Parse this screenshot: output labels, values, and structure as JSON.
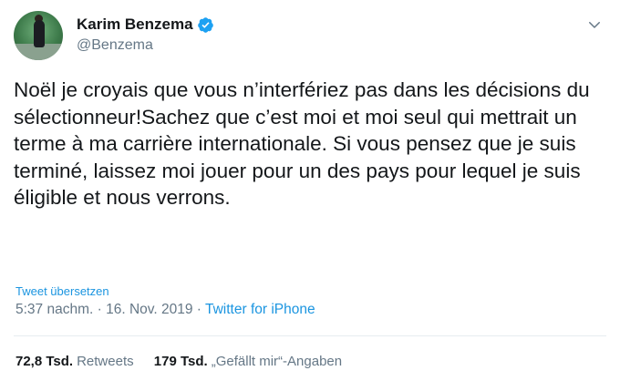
{
  "user": {
    "display_name": "Karim Benzema",
    "handle": "@Benzema",
    "verified": true
  },
  "tweet": {
    "text": "Noël je croyais que vous n’interfériez pas dans les décisions du sélectionneur!Sachez que c’est moi et moi seul qui mettrait un terme à ma carrière internationale. Si vous pensez que je suis terminé, laissez moi jouer pour un des pays pour lequel je suis éligible et nous verrons.",
    "translate_label": "Tweet übersetzen",
    "time": "5:37 nachm.",
    "separator_1": "·",
    "date": "16. Nov. 2019",
    "separator_2": "·",
    "source": "Twitter for iPhone"
  },
  "stats": {
    "retweets_count": "72,8 Tsd.",
    "retweets_label": "Retweets",
    "likes_count": "179 Tsd.",
    "likes_label": "„Gefällt mir“-Angaben"
  },
  "colors": {
    "link": "#1b95e0",
    "muted": "#657786",
    "verified": "#1da1f2"
  },
  "icons": [
    "verified-badge-icon",
    "chevron-down-icon"
  ]
}
